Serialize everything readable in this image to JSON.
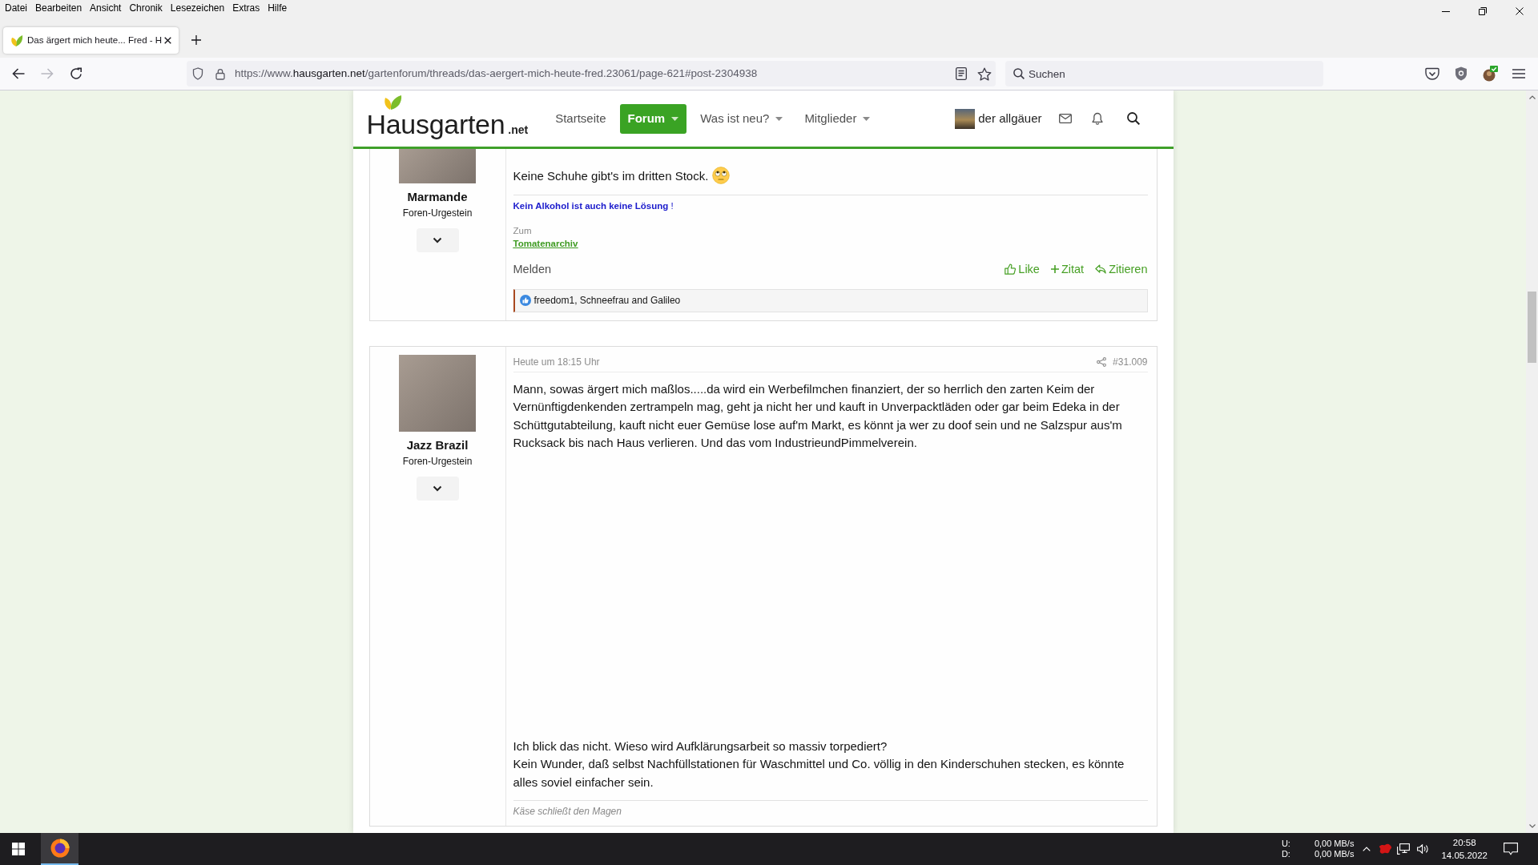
{
  "browser": {
    "menu": [
      "Datei",
      "Bearbeiten",
      "Ansicht",
      "Chronik",
      "Lesezeichen",
      "Extras",
      "Hilfe"
    ],
    "tabs": [
      {
        "title": "Das ärgert mich heute... Fred - H",
        "selected": true
      }
    ],
    "nav_buttons": [
      {
        "kind": "back",
        "disabled": false
      },
      {
        "kind": "forward",
        "disabled": true
      },
      {
        "kind": "reload",
        "disabled": false
      }
    ],
    "address": {
      "scheme": "https://www.",
      "host": "hausgarten.net",
      "path": "/gartenforum/threads/das-aergert-mich-heute-fred.23061/page-621#post-2304938"
    },
    "search": {
      "placeholder": "Suchen"
    }
  },
  "site_header": {
    "logo": {
      "name": "Hausgarten",
      "suffix": ".net"
    },
    "nav": [
      {
        "label": "Startseite",
        "selected": false,
        "dropdown": false
      },
      {
        "label": "Forum",
        "selected": true,
        "dropdown": true
      },
      {
        "label": "Was ist neu?",
        "selected": false,
        "dropdown": true
      },
      {
        "label": "Mitglieder",
        "selected": false,
        "dropdown": true
      }
    ],
    "user": {
      "name": "der allgäuer"
    }
  },
  "posts": [
    {
      "author": "Marmande",
      "role": "Foren-Urgestein",
      "blocks": [
        {
          "kind": "paragraph",
          "lines": [
            "Keine Schuhe gibt's im dritten Stock."
          ],
          "smilie": true
        }
      ],
      "signature": [
        {
          "kind": "slogan",
          "text": "**Kein Alkohol ist auch keine Lösung** !"
        },
        {
          "kind": "caption",
          "text": "Zum"
        },
        {
          "kind": "link",
          "text": "Tomatenarchiv"
        }
      ],
      "actions": {
        "report": "Melden",
        "links": [
          {
            "kind": "like",
            "label": "Like"
          },
          {
            "kind": "add_quote",
            "label": "Zitat"
          },
          {
            "kind": "quote",
            "label": "Zitieren"
          }
        ]
      },
      "reactions": {
        "names": "freedom1, Schneefrau and Galileo"
      }
    },
    {
      "date": "Heute um 18:15 Uhr",
      "number": "#31.009",
      "author": "Jazz Brazil",
      "role": "Foren-Urgestein",
      "blocks": [
        {
          "kind": "paragraph",
          "lines": [
            "Mann, sowas ärgert mich maßlos.....da wird ein Werbefilmchen finanziert, der so herrlich den zarten Keim der Vernünftigdenkenden zertrampeln mag, geht ja nicht her und kauft in Unverpacktläden oder gar beim Edeka in der Schüttgutabteilung, kauft nicht euer Gemüse lose auf'm Markt, es könnt ja wer zu doof sein und ne Salzspur aus'm Rucksack bis nach Haus verlieren. Und das vom IndustrieundPimmelverein."
          ]
        },
        {
          "kind": "embed"
        },
        {
          "kind": "paragraph",
          "lines": [
            "Ich blick das nicht. Wieso wird Aufklärungsarbeit so massiv torpediert?",
            "Kein Wunder, daß selbst Nachfüllstationen für Waschmittel und Co. völlig in den Kinderschuhen stecken, es könnte alles soviel einfacher sein."
          ]
        }
      ],
      "signature": [
        {
          "kind": "note",
          "text": "Käse schließt den Magen"
        }
      ]
    }
  ],
  "taskbar": {
    "apps": [
      {
        "selected": true
      }
    ],
    "network": {
      "upload_label": "U:",
      "upload_rate": "0,00 MB/s",
      "download_label": "D:",
      "download_rate": "0,00 MB/s"
    },
    "clock": {
      "time": "20:58",
      "date": "14.05.2022"
    }
  }
}
